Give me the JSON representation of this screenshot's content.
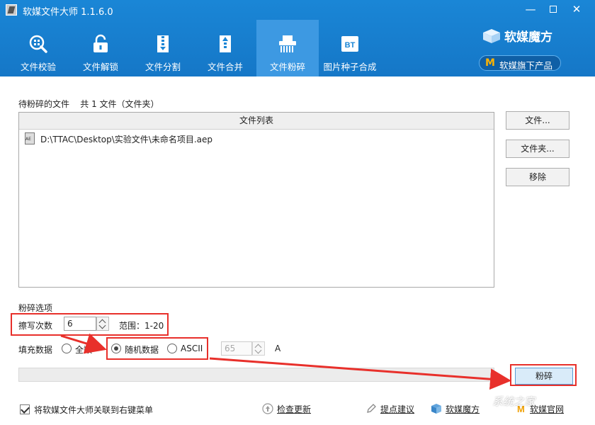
{
  "window": {
    "title": "软媒文件大师 1.1.6.0"
  },
  "tabs": [
    {
      "label": "文件校验",
      "icon": "magnifier-grid-icon"
    },
    {
      "label": "文件解锁",
      "icon": "unlock-icon"
    },
    {
      "label": "文件分割",
      "icon": "zip-split-icon"
    },
    {
      "label": "文件合并",
      "icon": "zip-merge-icon"
    },
    {
      "label": "文件粉碎",
      "icon": "shredder-icon",
      "active": true
    },
    {
      "label": "图片种子合成",
      "icon": "bt-icon",
      "badge": "BT"
    }
  ],
  "brand": {
    "name": "软媒魔方",
    "button_label": "软媒旗下产品",
    "button_mark": "M"
  },
  "files": {
    "label": "待粉碎的文件    共 1 文件（文件夹）",
    "list_header": "文件列表",
    "items": [
      "D:\\TTAC\\Desktop\\实验文件\\未命名项目.aep"
    ],
    "buttons": {
      "file": "文件...",
      "folder": "文件夹...",
      "remove": "移除"
    }
  },
  "options": {
    "title": "粉碎选项",
    "overwrite_label": "擦写次数",
    "overwrite_value": "6",
    "range_text": "范围：1-20",
    "fill_label": "填充数据",
    "fill_options": [
      "全数",
      "随机数据",
      "ASCII"
    ],
    "selected_fill": "随机数据",
    "ascii_value": "65",
    "ascii_char": "A"
  },
  "actions": {
    "shred": "粉碎"
  },
  "footer": {
    "context_menu": "将软媒文件大师关联到右键菜单",
    "check_update": "检查更新",
    "suggest": "提点建议",
    "mofang": "软媒魔方",
    "website": "软媒官网"
  },
  "watermark": "系统之家",
  "colors": {
    "header": "#1a86d6",
    "active_tab": "#3d99e2",
    "highlight": "#e8302b",
    "brand_mark": "#ffb400"
  }
}
